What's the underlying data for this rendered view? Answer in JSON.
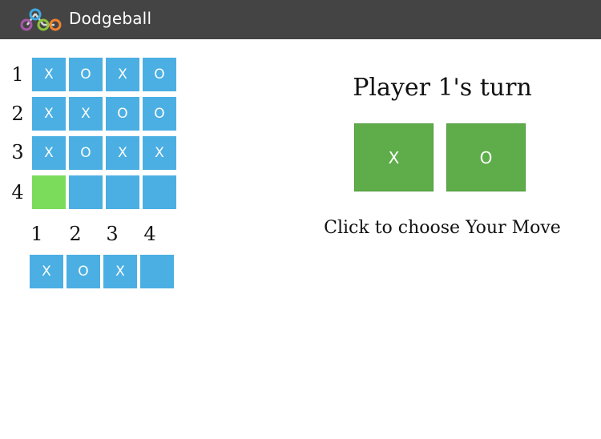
{
  "header": {
    "title": "Dodgeball",
    "logo_icon": "dodgeball-logo-icon"
  },
  "board": {
    "row_labels": [
      "1",
      "2",
      "3",
      "4"
    ],
    "rows": [
      [
        "X",
        "O",
        "X",
        "O"
      ],
      [
        "X",
        "X",
        "O",
        "O"
      ],
      [
        "X",
        "O",
        "X",
        "X"
      ],
      [
        "",
        "",
        "",
        ""
      ]
    ],
    "highlighted_cell": {
      "row": 4,
      "column": 1
    },
    "cell_color": "#4bafe3",
    "highlight_color": "#7bdc5c"
  },
  "dodge_row": {
    "column_labels": [
      "1",
      "2",
      "3",
      "4"
    ],
    "cells": [
      "X",
      "O",
      "X",
      ""
    ]
  },
  "turn": {
    "title": "Player 1's turn",
    "options": [
      {
        "label": "X"
      },
      {
        "label": "O"
      }
    ],
    "button_color": "#5ead4a",
    "instruction": "Click to choose Your Move"
  }
}
